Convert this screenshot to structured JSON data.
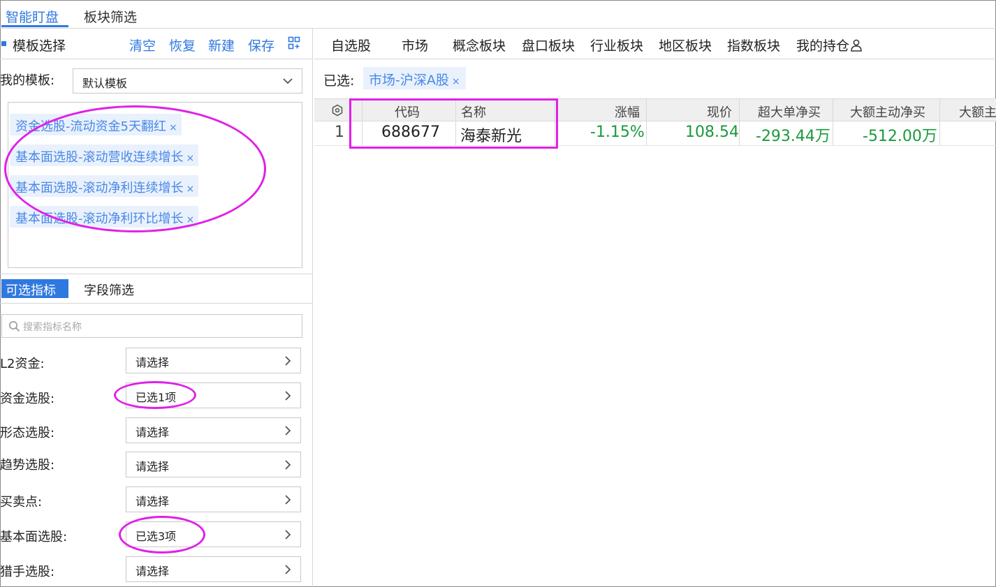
{
  "top_tabs": [
    {
      "label": "智能盯盘"
    },
    {
      "label": "板块筛选"
    }
  ],
  "left": {
    "title": "模板选择",
    "actions": [
      "清空",
      "恢复",
      "新建",
      "保存"
    ],
    "my_template_label": "我的模板:",
    "my_template_value": "默认模板",
    "template_tags": [
      "资金选股-流动资金5天翻红",
      "基本面选股-滚动营收连续增长",
      "基本面选股-滚动净利连续增长",
      "基本面选股-滚动净利环比增长"
    ],
    "tag_close": "×",
    "sub_tabs": [
      "可选指标",
      "字段筛选"
    ],
    "search_placeholder": "搜索指标名称",
    "indicators": [
      {
        "label": "L2资金:",
        "value": "请选择"
      },
      {
        "label": "资金选股:",
        "value": "已选1项"
      },
      {
        "label": "形态选股:",
        "value": "请选择"
      },
      {
        "label": "趋势选股:",
        "value": "请选择"
      },
      {
        "label": "买卖点:",
        "value": "请选择"
      },
      {
        "label": "基本面选股:",
        "value": "已选3项"
      },
      {
        "label": "猎手选股:",
        "value": "请选择"
      }
    ]
  },
  "right": {
    "nav": [
      "自选股",
      "市场",
      "概念板块",
      "盘口板块",
      "行业板块",
      "地区板块",
      "指数板块",
      "我的持仓"
    ],
    "selected_label": "已选:",
    "selected_tag": "市场-沪深A股",
    "columns": [
      "代码",
      "名称",
      "涨幅",
      "现价",
      "超大单净买",
      "大额主动净买",
      "大额主"
    ],
    "rows": [
      {
        "index": "1",
        "code": "688677",
        "name": "海泰新光",
        "change": "-1.15%",
        "price": "108.54",
        "super_large_net": "-293.44万",
        "large_active_net": "-512.00万"
      }
    ]
  },
  "colors": {
    "accent": "#2f78e0",
    "tag_bg": "#e9f1fd",
    "highlight": "#e020e8",
    "down_green": "#1a9a3a"
  }
}
